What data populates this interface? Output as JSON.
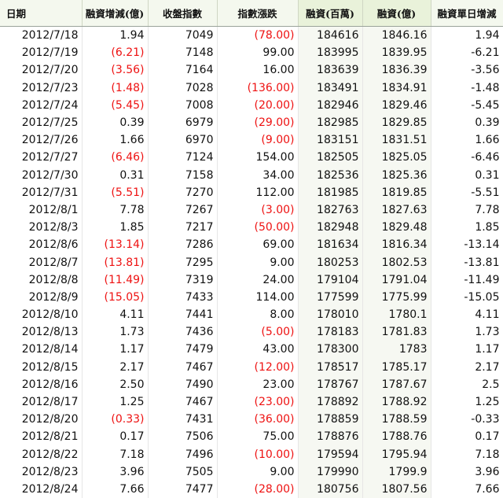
{
  "headers": [
    "日期",
    "融資增減(億)",
    "收盤指數",
    "指數漲跌",
    "融資(百萬)",
    "融資(億)",
    "融資單日增減"
  ],
  "rows": [
    [
      "2012/7/18",
      "1.94",
      "7049",
      "(78.00)",
      "184616",
      "1846.16",
      "1.94"
    ],
    [
      "2012/7/19",
      "(6.21)",
      "7148",
      "99.00",
      "183995",
      "1839.95",
      "-6.21"
    ],
    [
      "2012/7/20",
      "(3.56)",
      "7164",
      "16.00",
      "183639",
      "1836.39",
      "-3.56"
    ],
    [
      "2012/7/23",
      "(1.48)",
      "7028",
      "(136.00)",
      "183491",
      "1834.91",
      "-1.48"
    ],
    [
      "2012/7/24",
      "(5.45)",
      "7008",
      "(20.00)",
      "182946",
      "1829.46",
      "-5.45"
    ],
    [
      "2012/7/25",
      "0.39",
      "6979",
      "(29.00)",
      "182985",
      "1829.85",
      "0.39"
    ],
    [
      "2012/7/26",
      "1.66",
      "6970",
      "(9.00)",
      "183151",
      "1831.51",
      "1.66"
    ],
    [
      "2012/7/27",
      "(6.46)",
      "7124",
      "154.00",
      "182505",
      "1825.05",
      "-6.46"
    ],
    [
      "2012/7/30",
      "0.31",
      "7158",
      "34.00",
      "182536",
      "1825.36",
      "0.31"
    ],
    [
      "2012/7/31",
      "(5.51)",
      "7270",
      "112.00",
      "181985",
      "1819.85",
      "-5.51"
    ],
    [
      "2012/8/1",
      "7.78",
      "7267",
      "(3.00)",
      "182763",
      "1827.63",
      "7.78"
    ],
    [
      "2012/8/3",
      "1.85",
      "7217",
      "(50.00)",
      "182948",
      "1829.48",
      "1.85"
    ],
    [
      "2012/8/6",
      "(13.14)",
      "7286",
      "69.00",
      "181634",
      "1816.34",
      "-13.14"
    ],
    [
      "2012/8/7",
      "(13.81)",
      "7295",
      "9.00",
      "180253",
      "1802.53",
      "-13.81"
    ],
    [
      "2012/8/8",
      "(11.49)",
      "7319",
      "24.00",
      "179104",
      "1791.04",
      "-11.49"
    ],
    [
      "2012/8/9",
      "(15.05)",
      "7433",
      "114.00",
      "177599",
      "1775.99",
      "-15.05"
    ],
    [
      "2012/8/10",
      "4.11",
      "7441",
      "8.00",
      "178010",
      "1780.1",
      "4.11"
    ],
    [
      "2012/8/13",
      "1.73",
      "7436",
      "(5.00)",
      "178183",
      "1781.83",
      "1.73"
    ],
    [
      "2012/8/14",
      "1.17",
      "7479",
      "43.00",
      "178300",
      "1783",
      "1.17"
    ],
    [
      "2012/8/15",
      "2.17",
      "7467",
      "(12.00)",
      "178517",
      "1785.17",
      "2.17"
    ],
    [
      "2012/8/16",
      "2.50",
      "7490",
      "23.00",
      "178767",
      "1787.67",
      "2.5"
    ],
    [
      "2012/8/17",
      "1.25",
      "7467",
      "(23.00)",
      "178892",
      "1788.92",
      "1.25"
    ],
    [
      "2012/8/20",
      "(0.33)",
      "7431",
      "(36.00)",
      "178859",
      "1788.59",
      "-0.33"
    ],
    [
      "2012/8/21",
      "0.17",
      "7506",
      "75.00",
      "178876",
      "1788.76",
      "0.17"
    ],
    [
      "2012/8/22",
      "7.18",
      "7496",
      "(10.00)",
      "179594",
      "1795.94",
      "7.18"
    ],
    [
      "2012/8/23",
      "3.96",
      "7505",
      "9.00",
      "179990",
      "1799.9",
      "3.96"
    ],
    [
      "2012/8/24",
      "7.66",
      "7477",
      "(28.00)",
      "180756",
      "1807.56",
      "7.66"
    ]
  ],
  "colors": {
    "negative": "#ee1111",
    "text": "#111111",
    "header_bg": "#f4f8ee"
  }
}
